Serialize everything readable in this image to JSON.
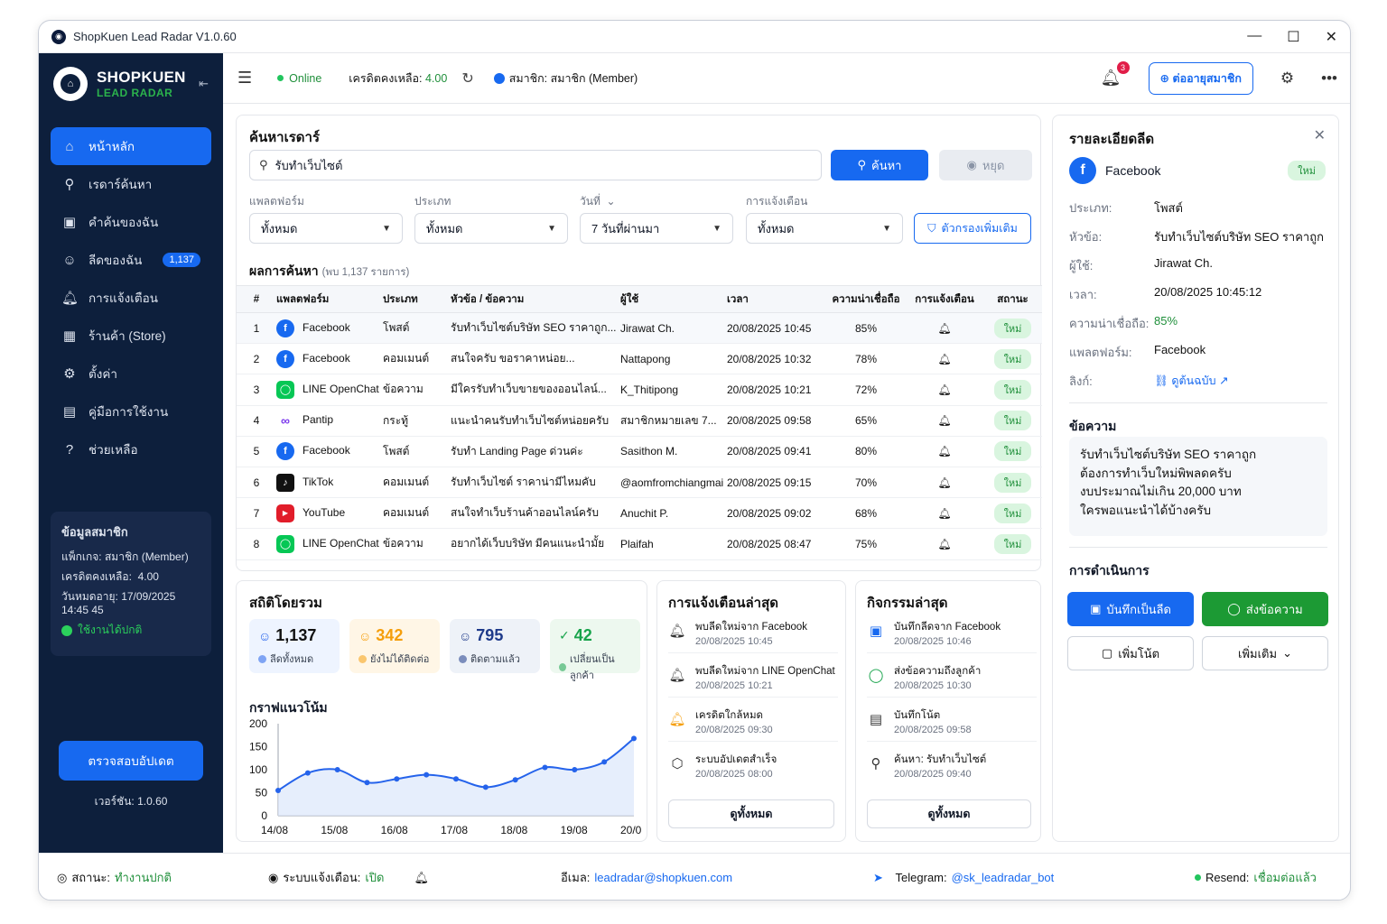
{
  "window": {
    "title": "ShopKuen Lead Radar V1.0.60"
  },
  "brand": {
    "name": "SHOPKUEN",
    "sub": "LEAD RADAR"
  },
  "sidebar": {
    "items": [
      {
        "label": "หน้าหลัก",
        "icon": "home-icon"
      },
      {
        "label": "เรดาร์ค้นหา",
        "icon": "search-icon"
      },
      {
        "label": "คำค้นของฉัน",
        "icon": "keyword-icon"
      },
      {
        "label": "ลีดของฉัน",
        "icon": "users-icon",
        "badge": "1,137"
      },
      {
        "label": "การแจ้งเตือน",
        "icon": "bell-icon"
      },
      {
        "label": "ร้านค้า (Store)",
        "icon": "store-icon"
      },
      {
        "label": "ตั้งค่า",
        "icon": "gear-icon"
      },
      {
        "label": "คู่มือการใช้งาน",
        "icon": "manual-icon"
      },
      {
        "label": "ช่วยเหลือ",
        "icon": "help-icon"
      }
    ],
    "member": {
      "title": "ข้อมูลสมาชิก",
      "package": "แพ็กเกจ: สมาชิก (Member)",
      "credit_label": "เครดิตคงเหลือ:",
      "credit_value": "4.00",
      "expire": "วันหมดอายุ: 17/09/2025 14:45 45",
      "status": "ใช้งานได้ปกติ"
    },
    "update_button": "ตรวจสอบอัปเดต",
    "version": "เวอร์ชัน: 1.0.60"
  },
  "topbar": {
    "online": "Online",
    "credit_label": "เครดิตคงเหลือ:",
    "credit_value": "4.00",
    "member": "สมาชิก: สมาชิก (Member)",
    "notif_count": "3",
    "contact_button": "ต่ออายุสมาชิก"
  },
  "search": {
    "title": "ค้นหาเรดาร์",
    "query": "รับทำเว็บไซต์",
    "search_button": "ค้นหา",
    "stop_button": "หยุด",
    "filters": [
      {
        "label": "แพลตฟอร์ม",
        "value": "ทั้งหมด"
      },
      {
        "label": "ประเภท",
        "value": "ทั้งหมด"
      },
      {
        "label": "วันที่",
        "value": "7 วันที่ผ่านมา"
      },
      {
        "label": "การแจ้งเตือน",
        "value": "ทั้งหมด"
      }
    ],
    "more_filters": "ตัวกรองเพิ่มเติม",
    "results_title": "ผลการค้นหา",
    "results_count": "(พบ 1,137 รายการ)",
    "columns": [
      "#",
      "แพลตฟอร์ม",
      "ประเภท",
      "หัวข้อ / ข้อความ",
      "ผู้ใช้",
      "เวลา",
      "ความน่าเชื่อถือ",
      "การแจ้งเตือน",
      "สถานะ"
    ],
    "rows": [
      {
        "n": "1",
        "platform": "Facebook",
        "p": "fb",
        "type": "โพสต์",
        "topic": "รับทำเว็บไซต์บริษัท SEO ราคาถูก...",
        "user": "Jirawat Ch.",
        "time": "20/08/2025 10:45",
        "score": "85%",
        "status": "ใหม่"
      },
      {
        "n": "2",
        "platform": "Facebook",
        "p": "fb",
        "type": "คอมเมนต์",
        "topic": "สนใจครับ ขอราคาหน่อย...",
        "user": "Nattapong",
        "time": "20/08/2025 10:32",
        "score": "78%",
        "status": "ใหม่"
      },
      {
        "n": "3",
        "platform": "LINE OpenChat",
        "p": "line",
        "type": "ข้อความ",
        "topic": "มีใครรับทำเว็บขายของออนไลน์...",
        "user": "K_Thitipong",
        "time": "20/08/2025 10:21",
        "score": "72%",
        "status": "ใหม่"
      },
      {
        "n": "4",
        "platform": "Pantip",
        "p": "pantip",
        "type": "กระทู้",
        "topic": "แนะนำคนรับทำเว็บไซต์หน่อยครับ",
        "user": "สมาชิกหมายเลข 7...",
        "time": "20/08/2025 09:58",
        "score": "65%",
        "status": "ใหม่"
      },
      {
        "n": "5",
        "platform": "Facebook",
        "p": "fb",
        "type": "โพสต์",
        "topic": "รับทำ Landing Page ด่วนค่ะ",
        "user": "Sasithon M.",
        "time": "20/08/2025 09:41",
        "score": "80%",
        "status": "ใหม่"
      },
      {
        "n": "6",
        "platform": "TikTok",
        "p": "tiktok",
        "type": "คอมเมนต์",
        "topic": "รับทำเว็บไซต์ ราคาน่ามีไหมคับ",
        "user": "@aomfromchiangmai",
        "time": "20/08/2025 09:15",
        "score": "70%",
        "status": "ใหม่"
      },
      {
        "n": "7",
        "platform": "YouTube",
        "p": "yt",
        "type": "คอมเมนต์",
        "topic": "สนใจทำเว็บร้านค้าออนไลน์ครับ",
        "user": "Anuchit P.",
        "time": "20/08/2025 09:02",
        "score": "68%",
        "status": "ใหม่"
      },
      {
        "n": "8",
        "platform": "LINE OpenChat",
        "p": "line",
        "type": "ข้อความ",
        "topic": "อยากได้เว็บบริษัท มีคนแนะนำมั้ย",
        "user": "Plaifah",
        "time": "20/08/2025 08:47",
        "score": "75%",
        "status": "ใหม่"
      }
    ]
  },
  "stats": {
    "title": "สถิติโดยรวม",
    "boxes": [
      {
        "value": "1,137",
        "label": "ลีดทั้งหมด",
        "color": "#2563eb",
        "bg": "#eef4ff",
        "icon": "users-icon"
      },
      {
        "value": "342",
        "label": "ยังไม่ได้ติดต่อ",
        "color": "#f59e0b",
        "bg": "#fff6e6",
        "icon": "user-pending-icon"
      },
      {
        "value": "795",
        "label": "ติดตามแล้ว",
        "color": "#1e3a8a",
        "bg": "#eef2f8",
        "icon": "user-followed-icon"
      },
      {
        "value": "42",
        "label": "เปลี่ยนเป็นลูกค้า",
        "color": "#16a34a",
        "bg": "#edf8ef",
        "icon": "check-icon"
      }
    ],
    "trend_title": "กราฟแนวโน้ม"
  },
  "chart_data": {
    "type": "line",
    "x": [
      "14/08",
      "",
      "15/08",
      "",
      "16/08",
      "",
      "17/08",
      "",
      "18/08",
      "",
      "19/08",
      "",
      "20/08"
    ],
    "xticks": [
      "14/08",
      "15/08",
      "16/08",
      "17/08",
      "18/08",
      "19/08",
      "20/08"
    ],
    "values": [
      55,
      93,
      100,
      72,
      80,
      89,
      80,
      62,
      78,
      105,
      100,
      117,
      168
    ],
    "ylim": [
      0,
      200
    ],
    "yticks": [
      0,
      50,
      100,
      150,
      200
    ],
    "color": "#2563eb"
  },
  "notifications": {
    "title": "การแจ้งเตือนล่าสุด",
    "items": [
      {
        "text": "พบลีดใหม่จาก Facebook",
        "date": "20/08/2025 10:45",
        "icon": "bell-icon"
      },
      {
        "text": "พบลีดใหม่จาก LINE OpenChat",
        "date": "20/08/2025 10:21",
        "icon": "bell-icon"
      },
      {
        "text": "เครดิตใกล้หมด",
        "date": "20/08/2025 09:30",
        "icon": "bell-warning-icon"
      },
      {
        "text": "ระบบอัปเดตสำเร็จ",
        "date": "20/08/2025 08:00",
        "icon": "update-icon"
      }
    ],
    "view_all": "ดูทั้งหมด"
  },
  "activities": {
    "title": "กิจกรรมล่าสุด",
    "items": [
      {
        "text": "บันทึกลีดจาก Facebook",
        "date": "20/08/2025 10:46",
        "icon": "save-icon"
      },
      {
        "text": "ส่งข้อความถึงลูกค้า",
        "date": "20/08/2025 10:30",
        "icon": "chat-icon"
      },
      {
        "text": "บันทึกโน้ต",
        "date": "20/08/2025 09:58",
        "icon": "note-icon"
      },
      {
        "text": "ค้นหา: รับทำเว็บไซต์",
        "date": "20/08/2025 09:40",
        "icon": "search-icon"
      }
    ],
    "view_all": "ดูทั้งหมด"
  },
  "detail": {
    "title": "รายละเอียดลีด",
    "platform": "Facebook",
    "status": "ใหม่",
    "fields": [
      {
        "label": "ประเภท:",
        "value": "โพสต์"
      },
      {
        "label": "หัวข้อ:",
        "value": "รับทำเว็บไซต์บริษัท SEO ราคาถูก"
      },
      {
        "label": "ผู้ใช้:",
        "value": "Jirawat Ch."
      },
      {
        "label": "เวลา:",
        "value": "20/08/2025 10:45:12"
      },
      {
        "label": "ความน่าเชื่อถือ:",
        "value": "85%"
      },
      {
        "label": "แพลตฟอร์ม:",
        "value": "Facebook"
      },
      {
        "label": "ลิงก์:",
        "value": "ดูต้นฉบับ"
      }
    ],
    "message_title": "ข้อความ",
    "message_lines": [
      "รับทำเว็บไซต์บริษัท SEO ราคาถูก",
      "ต้องการทำเว็บใหม่พิพลดครับ",
      "งบประมาณไม่เกิน 20,000 บาท",
      "ใครพอแนะนำได้บ้างครับ"
    ],
    "ops_title": "การดำเนินการ",
    "save_lead": "บันทึกเป็นลีด",
    "send_message": "ส่งข้อความ",
    "add_note": "เพิ่มโน้ต",
    "more": "เพิ่มเติม"
  },
  "statusbar": {
    "status_label": "สถานะ:",
    "status_value": "ทำงานปกติ",
    "notify_label": "ระบบแจ้งเตือน:",
    "notify_value": "เปิด",
    "email_label": "อีเมล:",
    "email_value": "leadradar@shopkuen.com",
    "telegram_label": "Telegram:",
    "telegram_value": "@sk_leadradar_bot",
    "resend_label": "Resend:",
    "resend_value": "เชื่อมต่อแล้ว"
  }
}
